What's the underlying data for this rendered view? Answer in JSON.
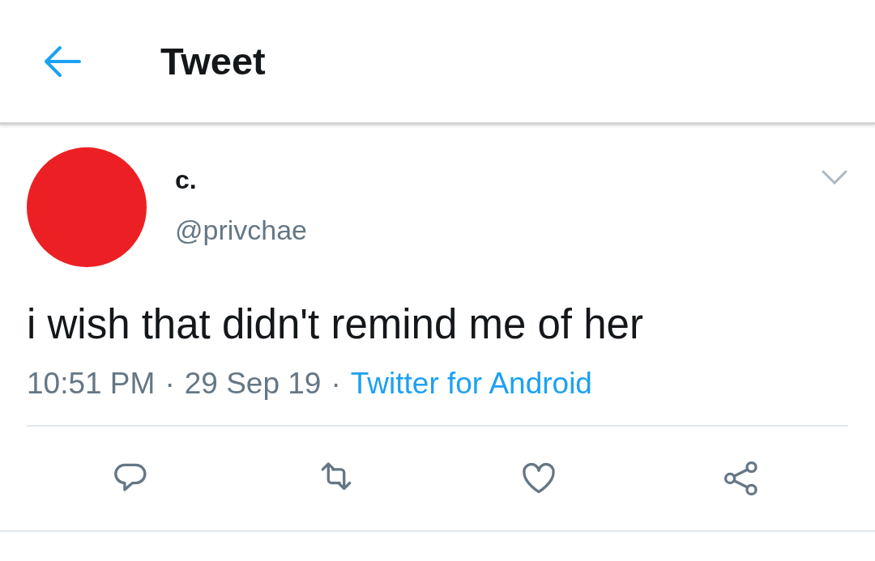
{
  "header": {
    "title": "Tweet"
  },
  "tweet": {
    "name": "c.",
    "handle": "@privchae",
    "text": "i wish that didn't remind me of her",
    "meta": [
      {
        "kind": "text",
        "text": "10:51 PM"
      },
      {
        "kind": "separator",
        "text": "·"
      },
      {
        "kind": "text",
        "text": "29 Sep 19"
      },
      {
        "kind": "separator",
        "text": "·"
      },
      {
        "kind": "link",
        "text": "Twitter for Android"
      }
    ]
  },
  "actions": [
    {
      "kind": "reply"
    },
    {
      "kind": "retweet"
    },
    {
      "kind": "like"
    },
    {
      "kind": "share"
    }
  ]
}
